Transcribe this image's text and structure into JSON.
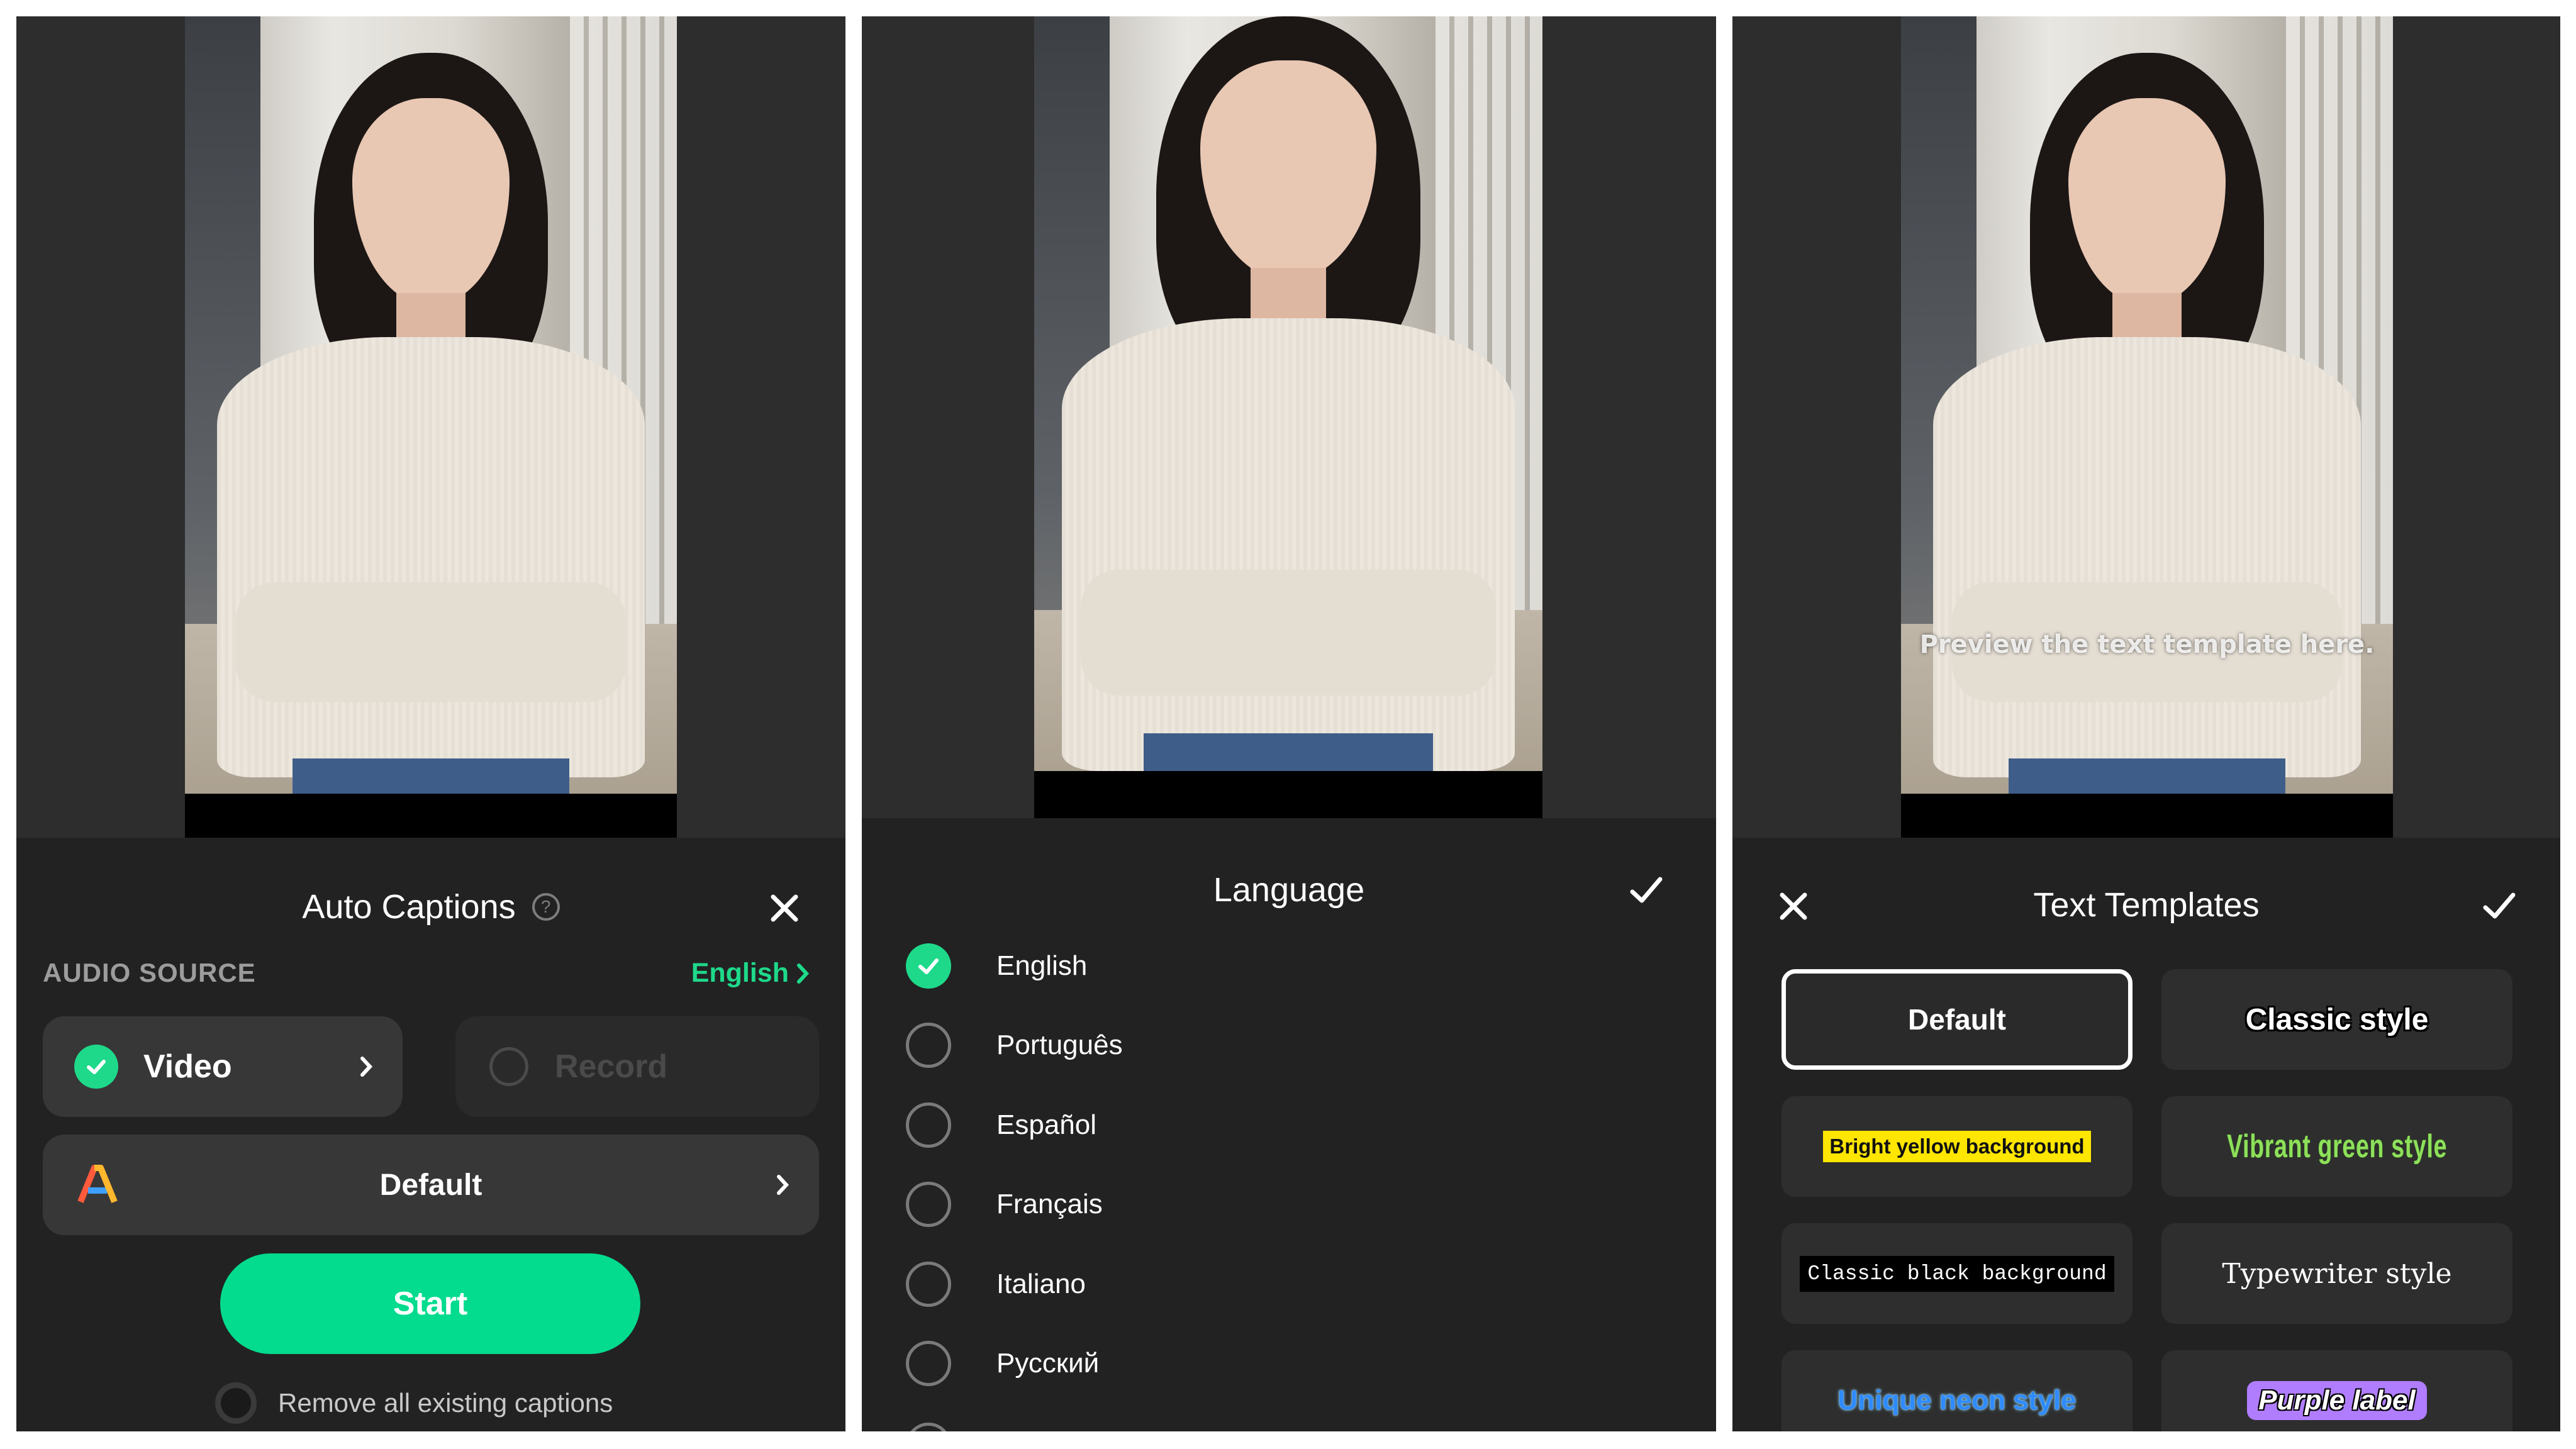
{
  "panel1": {
    "title": "Auto Captions",
    "section_label": "AUDIO SOURCE",
    "language_link": "English",
    "source_video": "Video",
    "source_record": "Record",
    "style_value": "Default",
    "start_label": "Start",
    "remove_label": "Remove all existing captions",
    "icons": [
      "help-icon",
      "close-icon",
      "check-icon",
      "chevron-right-icon",
      "caption-style-icon"
    ]
  },
  "panel2": {
    "title": "Language",
    "languages": [
      {
        "label": "English",
        "selected": true
      },
      {
        "label": "Português",
        "selected": false
      },
      {
        "label": "Español",
        "selected": false
      },
      {
        "label": "Français",
        "selected": false
      },
      {
        "label": "Italiano",
        "selected": false
      },
      {
        "label": "Русский",
        "selected": false
      }
    ]
  },
  "panel3": {
    "title": "Text Templates",
    "preview_text": "Preview the text template here.",
    "templates": [
      {
        "label": "Default",
        "selected": true
      },
      {
        "label": "Classic style"
      },
      {
        "label": "Bright yellow background"
      },
      {
        "label": "Vibrant green style"
      },
      {
        "label": "Classic black background"
      },
      {
        "label": "Typewriter style"
      },
      {
        "label": "Unique neon style"
      },
      {
        "label": "Purple label"
      }
    ]
  },
  "colors": {
    "accent": "#1ed98a",
    "start_button": "#03db8e",
    "panel_bg": "#222222",
    "card_bg": "#373737"
  }
}
